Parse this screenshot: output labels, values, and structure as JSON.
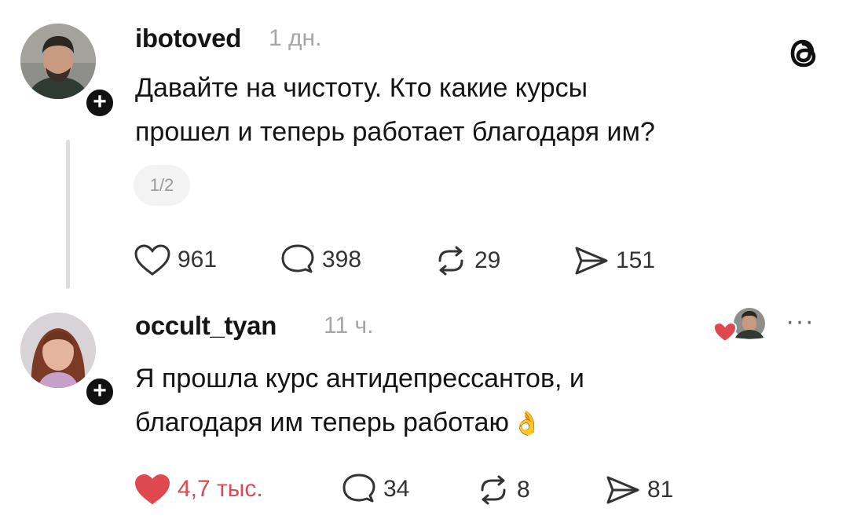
{
  "posts": [
    {
      "username": "ibotoved",
      "time": "1 дн.",
      "lines": [
        "Давайте на чистоту. Кто какие курсы",
        "прошел и теперь работает благодаря им?"
      ],
      "page_indicator": "1/2",
      "actions": {
        "likes": "961",
        "comments": "398",
        "reposts": "29",
        "shares": "151"
      }
    },
    {
      "username": "occult_tyan",
      "time": "11 ч.",
      "lines": [
        "Я прошла курс антидепрессантов, и",
        "благодаря им теперь работаю"
      ],
      "emoji": "👌",
      "actions": {
        "likes": "4,7 тыс.",
        "comments": "34",
        "reposts": "8",
        "shares": "81"
      }
    }
  ],
  "follow_symbol": "+",
  "more_menu": "···",
  "colors": {
    "liked": "#e0484f",
    "muted": "#a6a6a6",
    "text": "#141414"
  },
  "icons": [
    "threads-logo-icon",
    "heart-icon",
    "comment-icon",
    "repost-icon",
    "share-icon",
    "more-icon"
  ]
}
